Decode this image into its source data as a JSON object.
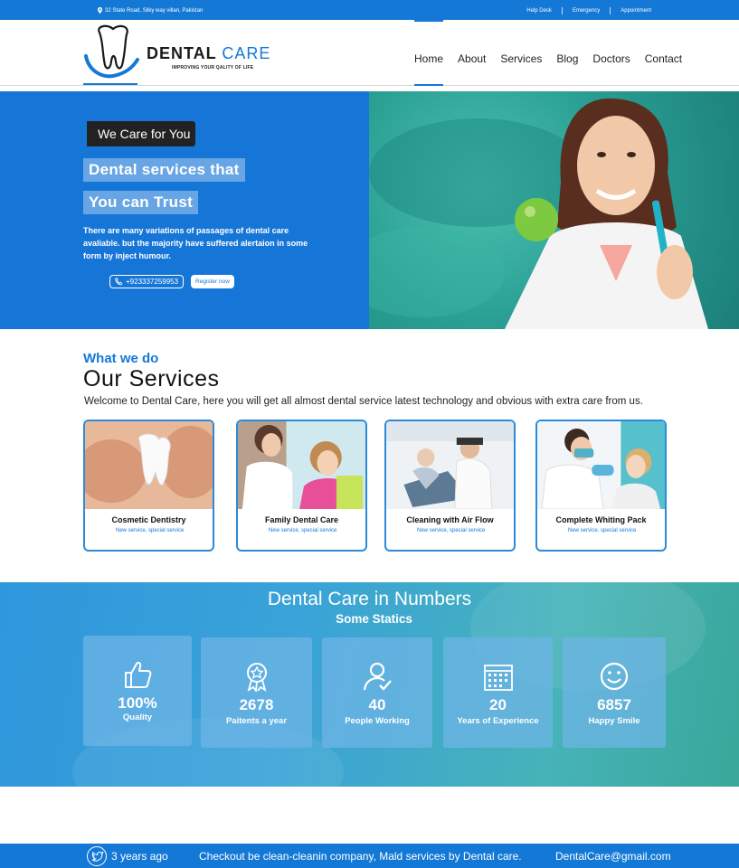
{
  "topbar": {
    "address": "32 State Road, Silky way villan, Pakistan",
    "links": [
      "Help Desk",
      "Emergency",
      "Appointment"
    ]
  },
  "brand": {
    "name_part1": "DENTAL",
    "name_part2": "CARE",
    "tagline": "IMPROVING YOUR QALITY OF LIFE"
  },
  "nav": {
    "items": [
      "Home",
      "About",
      "Services",
      "Blog",
      "Doctors",
      "Contact"
    ],
    "active": "Home"
  },
  "hero": {
    "badge": "We Care for You",
    "headline1": "Dental services that",
    "headline2": "You can Trust",
    "description": "There are many variations of passages of dental care avaliable. but the majority have suffered alertaion in some form by inject humour.",
    "phone": "+923337259953",
    "register": "Register now"
  },
  "services": {
    "kicker": "What we do",
    "title": "Our Services",
    "intro": "Welcome to Dental Care, here you will get all almost dental service latest technology and obvious with extra care from us.",
    "cards": [
      {
        "title": "Cosmetic Dentistry",
        "sub": "New service, special service"
      },
      {
        "title": "Family Dental Care",
        "sub": "New service, special service"
      },
      {
        "title": "Cleaning with Air Flow",
        "sub": "New service, special service"
      },
      {
        "title": "Complete Whiting Pack",
        "sub": "New service, special service"
      }
    ]
  },
  "numbers": {
    "title": "Dental Care in Numbers",
    "subtitle": "Some Statics",
    "stats": [
      {
        "value": "100%",
        "label": "Quality",
        "icon": "thumbs-up-icon"
      },
      {
        "value": "2678",
        "label": "Paitents a year",
        "icon": "award-ribbon-icon"
      },
      {
        "value": "40",
        "label": "People Working",
        "icon": "user-check-icon"
      },
      {
        "value": "20",
        "label": "Years of Experience",
        "icon": "calendar-icon"
      },
      {
        "value": "6857",
        "label": "Happy Smile",
        "icon": "smiley-icon"
      }
    ]
  },
  "footer": {
    "time": "3 years ago",
    "message": "Checkout be clean-cleanin company, Mald services by Dental care.",
    "email": "DentalCare@gmail.com"
  },
  "colors": {
    "primary": "#1479d6",
    "hero_left": "#1676d8",
    "teal": "#2a9f94"
  }
}
